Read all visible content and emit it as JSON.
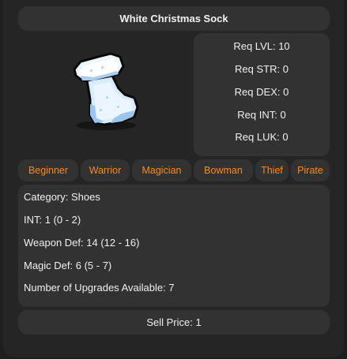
{
  "item": {
    "name": "White Christmas Sock",
    "icon": "white-christmas-sock-icon"
  },
  "requirements": {
    "level": "Req LVL: 10",
    "str": "Req STR: 0",
    "dex": "Req DEX: 0",
    "int": "Req INT: 0",
    "luk": "Req LUK: 0"
  },
  "jobs": [
    {
      "label": "Beginner"
    },
    {
      "label": "Warrior"
    },
    {
      "label": "Magician"
    },
    {
      "label": "Bowman"
    },
    {
      "label": "Thief"
    },
    {
      "label": "Pirate"
    }
  ],
  "info": {
    "category": "Category: Shoes",
    "int": "INT: 1 (0 - 2)",
    "weapon_def": "Weapon Def: 14 (12 - 16)",
    "magic_def": "Magic Def: 6 (5 - 7)",
    "upgrades": "Number of Upgrades Available: 7"
  },
  "sell_price": "Sell Price: 1",
  "colors": {
    "job_label": "#f08c2a",
    "box_bg": "#323232",
    "panel_bg": "#252525"
  }
}
